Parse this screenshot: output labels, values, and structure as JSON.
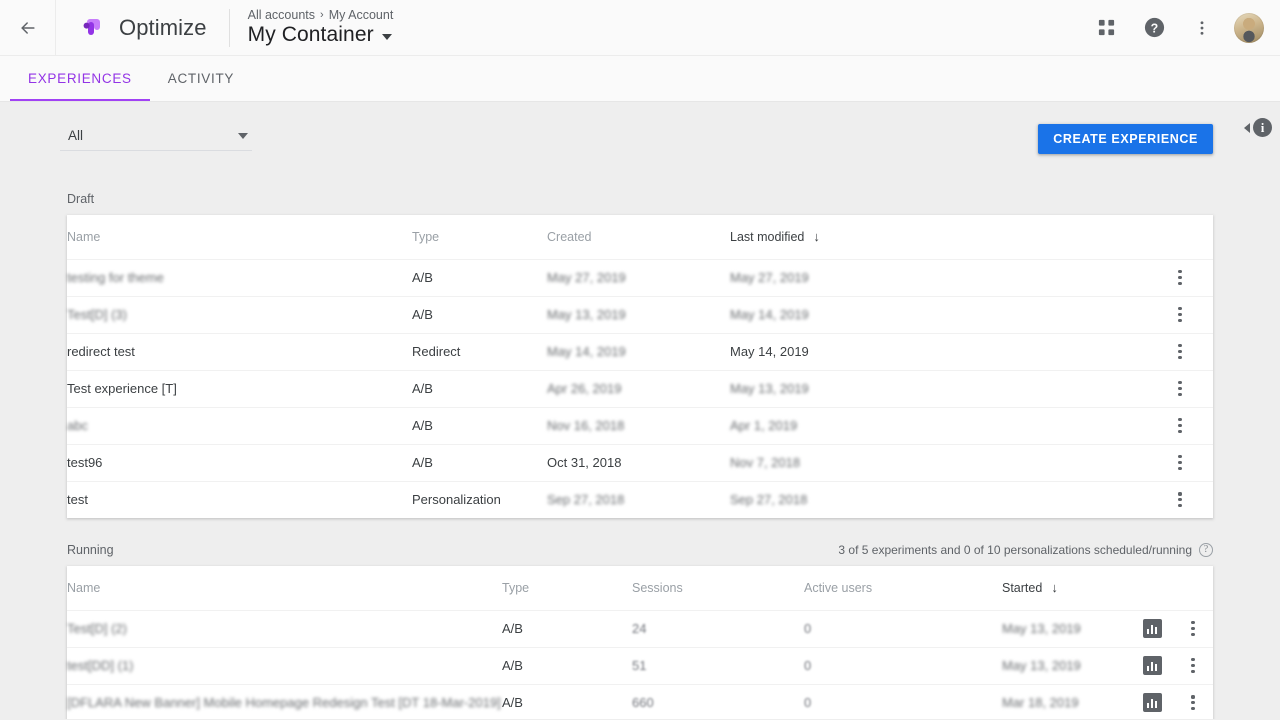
{
  "topbar": {
    "back_icon": "arrow-left-icon",
    "product_name": "Optimize",
    "logo_icon": "optimize-logo-icon",
    "breadcrumb": {
      "root": "All accounts",
      "separator": "›",
      "account": "My Account"
    },
    "container_title": "My Container",
    "apps_icon": "apps-grid-icon",
    "help_icon": "help-icon",
    "more_icon": "more-vert-icon",
    "avatar_label": "account-avatar"
  },
  "tabs": [
    {
      "label": "EXPERIENCES",
      "active": true
    },
    {
      "label": "ACTIVITY",
      "active": false
    }
  ],
  "toolbar": {
    "filter_value": "All",
    "create_label": "CREATE EXPERIENCE",
    "info_panel_label": "i"
  },
  "draft": {
    "title": "Draft",
    "columns": [
      "Name",
      "Type",
      "Created",
      "Last modified"
    ],
    "sort_column": "Last modified",
    "sort_direction": "↓",
    "rows": [
      {
        "name": "testing for theme",
        "name_blur": true,
        "type": "A/B",
        "created": "May 27, 2019",
        "modified": "May 27, 2019",
        "created_blur": true,
        "modified_blur": true
      },
      {
        "name": "Test[D] (3)",
        "name_blur": true,
        "type": "A/B",
        "created": "May 13, 2019",
        "modified": "May 14, 2019",
        "created_blur": true,
        "modified_blur": true
      },
      {
        "name": "redirect test",
        "name_blur": false,
        "type": "Redirect",
        "created": "May 14, 2019",
        "modified": "May 14, 2019",
        "created_blur": true,
        "modified_blur": false
      },
      {
        "name": "Test experience [T]",
        "name_blur": false,
        "type": "A/B",
        "created": "Apr 26, 2019",
        "modified": "May 13, 2019",
        "created_blur": true,
        "modified_blur": true
      },
      {
        "name": "abc",
        "name_blur": true,
        "type": "A/B",
        "created": "Nov 16, 2018",
        "modified": "Apr 1, 2019",
        "created_blur": true,
        "modified_blur": true
      },
      {
        "name": "test96",
        "name_blur": false,
        "type": "A/B",
        "created": "Oct 31, 2018",
        "modified": "Nov 7, 2018",
        "created_blur": false,
        "modified_blur": true
      },
      {
        "name": "test",
        "name_blur": false,
        "type": "Personalization",
        "created": "Sep 27, 2018",
        "modified": "Sep 27, 2018",
        "created_blur": true,
        "modified_blur": true
      }
    ],
    "row_menu_icon": "more-vert-icon"
  },
  "running": {
    "title": "Running",
    "quota_note": "3 of 5 experiments and 0 of 10 personalizations scheduled/running",
    "quota_help_icon": "help-outline-icon",
    "columns": [
      "Name",
      "Type",
      "Sessions",
      "Active users",
      "Started"
    ],
    "sort_column": "Started",
    "sort_direction": "↓",
    "rows": [
      {
        "name": "Test[D] (2)",
        "name_blur": true,
        "type": "A/B",
        "sessions": "24",
        "active_users": "0",
        "started": "May 13, 2019",
        "started_blur": true,
        "report_icon": "bar-chart-icon",
        "menu_icon": "more-vert-icon"
      },
      {
        "name": "test[DD] (1)",
        "name_blur": true,
        "type": "A/B",
        "sessions": "51",
        "active_users": "0",
        "started": "May 13, 2019",
        "started_blur": true,
        "report_icon": "bar-chart-icon",
        "menu_icon": "more-vert-icon"
      },
      {
        "name": "[DFLARA New Banner] Mobile Homepage Redesign Test [DT 18-Mar-2019]",
        "name_blur": true,
        "type": "A/B",
        "sessions": "660",
        "active_users": "0",
        "started": "Mar 18, 2019",
        "started_blur": true,
        "report_icon": "bar-chart-icon",
        "menu_icon": "more-vert-icon"
      }
    ]
  },
  "colors": {
    "accent_purple": "#a142f4",
    "primary_blue": "#1a73e8",
    "page_bg": "#eeeeee",
    "header_bg": "#fafafa",
    "text_primary": "#3c4043",
    "text_secondary": "#5f6368",
    "text_muted": "#9aa0a6"
  }
}
